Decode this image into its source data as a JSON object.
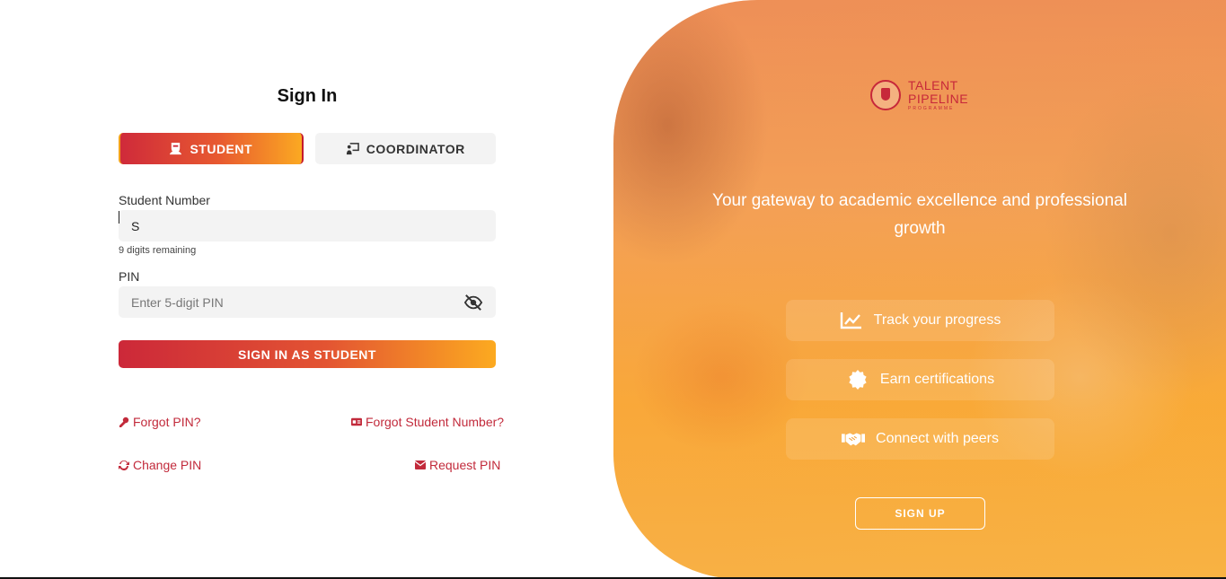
{
  "signin": {
    "title": "Sign In",
    "tabs": [
      {
        "label": "STUDENT",
        "icon": "student-icon",
        "active": true
      },
      {
        "label": "COORDINATOR",
        "icon": "presentation-icon",
        "active": false
      }
    ],
    "student_number": {
      "label": "Student Number",
      "value": "S",
      "hint": "9 digits remaining"
    },
    "pin": {
      "label": "PIN",
      "placeholder": "Enter 5-digit PIN",
      "icon": "eye-slash-icon"
    },
    "submit_label": "SIGN IN AS STUDENT",
    "links": {
      "forgot_pin": "Forgot PIN?",
      "forgot_student_number": "Forgot Student Number?",
      "change_pin": "Change PIN",
      "request_pin": "Request PIN"
    }
  },
  "promo": {
    "logo": {
      "line1": "TALENT",
      "line2": "PIPELINE",
      "line3": "PROGRAMME"
    },
    "tagline": "Your gateway to academic excellence and professional growth",
    "features": [
      {
        "label": "Track your progress",
        "icon": "chart-line-icon"
      },
      {
        "label": "Earn certifications",
        "icon": "certificate-icon"
      },
      {
        "label": "Connect with peers",
        "icon": "handshake-icon"
      }
    ],
    "signup_label": "SIGN UP"
  },
  "colors": {
    "accent_red": "#c7283a",
    "accent_orange": "#fba922",
    "input_bg": "#f3f3f3"
  }
}
